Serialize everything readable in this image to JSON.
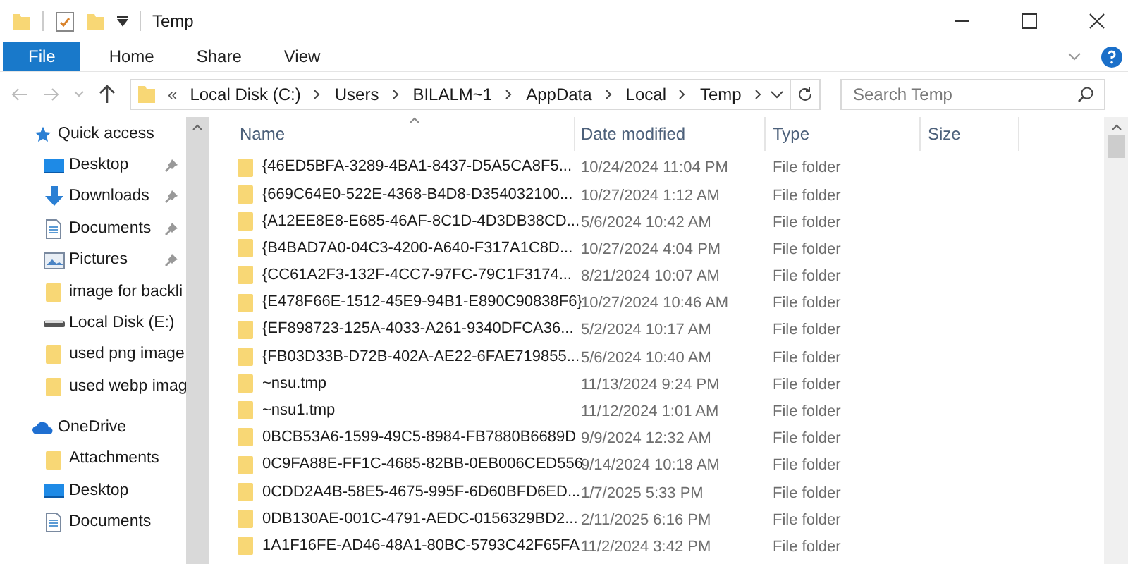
{
  "window": {
    "title": "Temp"
  },
  "ribbon": {
    "tabs": [
      {
        "label": "File",
        "selected": true
      },
      {
        "label": "Home",
        "selected": false
      },
      {
        "label": "Share",
        "selected": false
      },
      {
        "label": "View",
        "selected": false
      }
    ]
  },
  "address": {
    "overflow": "«",
    "crumbs": [
      "Local Disk (C:)",
      "Users",
      "BILALM~1",
      "AppData",
      "Local",
      "Temp"
    ]
  },
  "search": {
    "placeholder": "Search Temp"
  },
  "sidebar": {
    "items": [
      {
        "label": "Quick access",
        "kind": "star",
        "pinned": false,
        "header": true
      },
      {
        "label": "Desktop",
        "kind": "desktop",
        "pinned": true,
        "header": false
      },
      {
        "label": "Downloads",
        "kind": "downloads",
        "pinned": true,
        "header": false
      },
      {
        "label": "Documents",
        "kind": "documents",
        "pinned": true,
        "header": false
      },
      {
        "label": "Pictures",
        "kind": "pictures",
        "pinned": true,
        "header": false
      },
      {
        "label": "image for backli",
        "kind": "folder",
        "pinned": false,
        "header": false
      },
      {
        "label": "Local Disk (E:)",
        "kind": "drive",
        "pinned": false,
        "header": false
      },
      {
        "label": "used png image",
        "kind": "folder",
        "pinned": false,
        "header": false
      },
      {
        "label": "used webp imag",
        "kind": "folder",
        "pinned": false,
        "header": false
      },
      {
        "label": "OneDrive",
        "kind": "cloud",
        "pinned": false,
        "header": true
      },
      {
        "label": "Attachments",
        "kind": "folder",
        "pinned": false,
        "header": false
      },
      {
        "label": "Desktop",
        "kind": "desktop",
        "pinned": false,
        "header": false
      },
      {
        "label": "Documents",
        "kind": "documents",
        "pinned": false,
        "header": false
      }
    ]
  },
  "table": {
    "columns": [
      "Name",
      "Date modified",
      "Type",
      "Size"
    ],
    "rows": [
      {
        "name": "{46ED5BFA-3289-4BA1-8437-D5A5CA8F5...",
        "date": "10/24/2024 11:04 PM",
        "type": "File folder"
      },
      {
        "name": "{669C64E0-522E-4368-B4D8-D354032100...",
        "date": "10/27/2024 1:12 AM",
        "type": "File folder"
      },
      {
        "name": "{A12EE8E8-E685-46AF-8C1D-4D3DB38CD...",
        "date": "5/6/2024 10:42 AM",
        "type": "File folder"
      },
      {
        "name": "{B4BAD7A0-04C3-4200-A640-F317A1C8D...",
        "date": "10/27/2024 4:04 PM",
        "type": "File folder"
      },
      {
        "name": "{CC61A2F3-132F-4CC7-97FC-79C1F3174...",
        "date": "8/21/2024 10:07 AM",
        "type": "File folder"
      },
      {
        "name": "{E478F66E-1512-45E9-94B1-E890C90838F6}",
        "date": "10/27/2024 10:46 AM",
        "type": "File folder"
      },
      {
        "name": "{EF898723-125A-4033-A261-9340DFCA36...",
        "date": "5/2/2024 10:17 AM",
        "type": "File folder"
      },
      {
        "name": "{FB03D33B-D72B-402A-AE22-6FAE719855...",
        "date": "5/6/2024 10:40 AM",
        "type": "File folder"
      },
      {
        "name": "~nsu.tmp",
        "date": "11/13/2024 9:24 PM",
        "type": "File folder"
      },
      {
        "name": "~nsu1.tmp",
        "date": "11/12/2024 1:01 AM",
        "type": "File folder"
      },
      {
        "name": "0BCB53A6-1599-49C5-8984-FB7880B6689D",
        "date": "9/9/2024 12:32 AM",
        "type": "File folder"
      },
      {
        "name": "0C9FA88E-FF1C-4685-82BB-0EB006CED556",
        "date": "9/14/2024 10:18 AM",
        "type": "File folder"
      },
      {
        "name": "0CDD2A4B-58E5-4675-995F-6D60BFD6ED...",
        "date": "1/7/2025 5:33 PM",
        "type": "File folder"
      },
      {
        "name": "0DB130AE-001C-4791-AEDC-0156329BD2...",
        "date": "2/11/2025 6:16 PM",
        "type": "File folder"
      },
      {
        "name": "1A1F16FE-AD46-48A1-80BC-5793C42F65FA",
        "date": "11/2/2024 3:42 PM",
        "type": "File folder"
      }
    ]
  }
}
